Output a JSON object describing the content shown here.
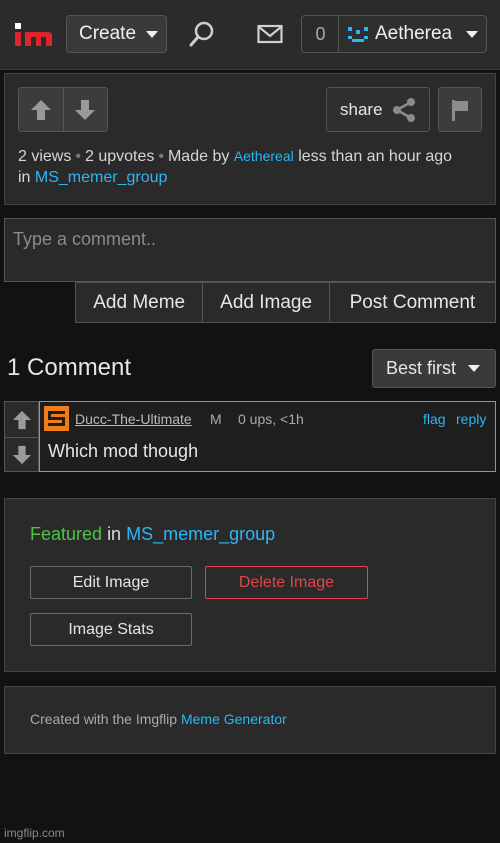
{
  "topbar": {
    "create_label": "Create",
    "notification_count": "0",
    "username": "Aetherea",
    "icons": [
      "search-icon",
      "mail-icon",
      "chevron-down-icon"
    ]
  },
  "post": {
    "share_label": "share",
    "views": "2 views",
    "upvotes": "2 upvotes",
    "made_by_prefix": "Made by",
    "author": "Aethereal",
    "time": "less than an hour ago",
    "in_prefix": "in",
    "group": "MS_memer_group"
  },
  "comment_form": {
    "placeholder": "Type a comment..",
    "add_meme": "Add Meme",
    "add_image": "Add Image",
    "post_comment": "Post Comment"
  },
  "comments": {
    "title": "1 Comment",
    "sort_label": "Best first",
    "items": [
      {
        "username": "Ducc-The-Ultimate",
        "badge": "M",
        "meta": "0 ups, <1h",
        "flag": "flag",
        "reply": "reply",
        "text": "Which mod though"
      }
    ]
  },
  "featured": {
    "label": "Featured",
    "in_text": "in",
    "group": "MS_memer_group",
    "edit_image": "Edit Image",
    "delete_image": "Delete Image",
    "image_stats": "Image Stats"
  },
  "footer": {
    "created_with": "Created with the Imgflip",
    "generator_link": "Meme Generator",
    "watermark": "imgflip.com"
  },
  "colors": {
    "accent_blue": "#2db6f5",
    "featured_green": "#4ec24a",
    "danger_red": "#e04545",
    "logo_red": "#e0242d"
  }
}
